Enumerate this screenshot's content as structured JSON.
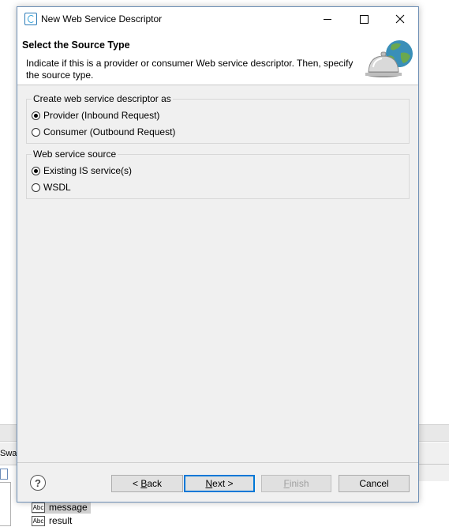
{
  "window": {
    "title": "New Web Service Descriptor"
  },
  "header": {
    "title": "Select the Source Type",
    "description": "Indicate if this is a provider or consumer Web service descriptor. Then, specify the source type."
  },
  "descriptor_group": {
    "legend": "Create web service descriptor as",
    "options": [
      {
        "label": "Provider (Inbound Request)",
        "checked": true
      },
      {
        "label": "Consumer (Outbound Request)",
        "checked": false
      }
    ]
  },
  "source_group": {
    "legend": "Web service source",
    "options": [
      {
        "label": "Existing IS service(s)",
        "checked": true
      },
      {
        "label": "WSDL",
        "checked": false
      }
    ]
  },
  "buttons": {
    "back_pre": "< ",
    "back_u": "B",
    "back_post": "ack",
    "next_u": "N",
    "next_post": "ext >",
    "finish_u": "F",
    "finish_post": "inish",
    "cancel": "Cancel"
  },
  "background": {
    "swap_text": "Swa",
    "rows": [
      "message",
      "result"
    ],
    "abc_icon": "Abc"
  }
}
